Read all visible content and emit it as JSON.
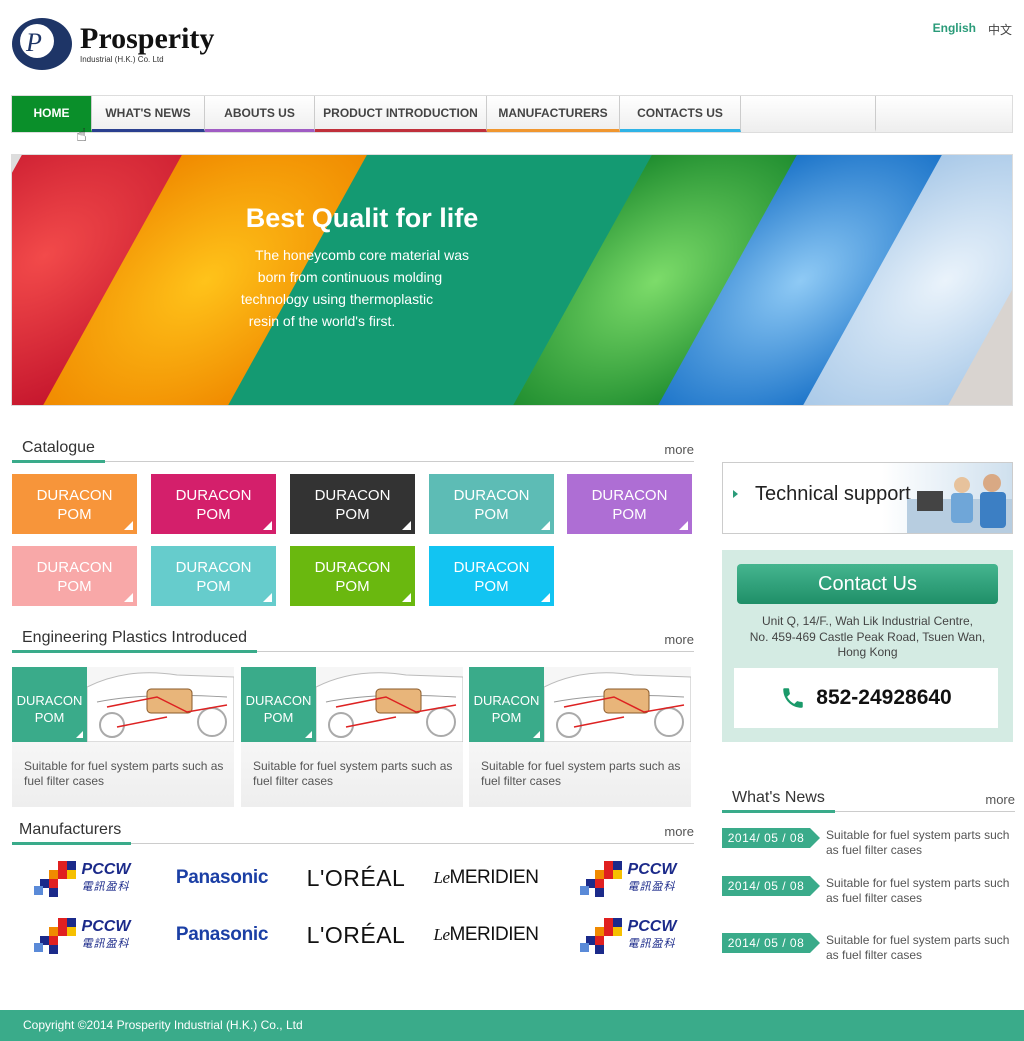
{
  "header": {
    "logo_letter": "P",
    "company_name": "Prosperity",
    "company_sub": "Industrial (H.K.) Co. Ltd",
    "lang_en": "English",
    "lang_zh": "中文"
  },
  "nav": {
    "items": [
      {
        "label": "HOME",
        "underline": "#0a8f2a"
      },
      {
        "label": "WHAT'S NEWS",
        "underline": "#2a3f8f"
      },
      {
        "label": "ABOUTS US",
        "underline": "#a05cc4"
      },
      {
        "label": "PRODUCT INTRODUCTION",
        "underline": "#c0303b"
      },
      {
        "label": "MANUFACTURERS",
        "underline": "#f0962f"
      },
      {
        "label": "CONTACTS US",
        "underline": "#2fb3e6"
      }
    ]
  },
  "banner": {
    "title": "Best Qualit for life",
    "body_lines": [
      "The honeycomb core material was",
      "born  from continuous molding",
      "technology using  thermoplastic",
      "resin of the world's  first."
    ],
    "green_color": "#149a72"
  },
  "catalogue": {
    "title": "Catalogue",
    "more": "more",
    "tiles": [
      {
        "line1": "DURACON",
        "line2": "POM",
        "color": "#f7953a"
      },
      {
        "line1": "DURACON",
        "line2": "POM",
        "color": "#d41f6b"
      },
      {
        "line1": "DURACON",
        "line2": "POM",
        "color": "#333333"
      },
      {
        "line1": "DURACON",
        "line2": "POM",
        "color": "#5dbcb5"
      },
      {
        "line1": "DURACON",
        "line2": "POM",
        "color": "#ae6ed4"
      },
      {
        "line1": "DURACON",
        "line2": "POM",
        "color": "#f8a8a8"
      },
      {
        "line1": "DURACON",
        "line2": "POM",
        "color": "#66cccc"
      },
      {
        "line1": "DURACON",
        "line2": "POM",
        "color": "#6ab80f"
      },
      {
        "line1": "DURACON",
        "line2": "POM",
        "color": "#12c4f2"
      }
    ]
  },
  "engineering": {
    "title": "Engineering Plastics Introduced",
    "more": "more",
    "cards": [
      {
        "line1": "DURACON",
        "line2": "POM",
        "desc": "Suitable for fuel system parts such as fuel filter cases"
      },
      {
        "line1": "DURACON",
        "line2": "POM",
        "desc": "Suitable for fuel system parts such as fuel filter cases"
      },
      {
        "line1": "DURACON",
        "line2": "POM",
        "desc": "Suitable for fuel system parts such as fuel filter cases"
      }
    ]
  },
  "manufacturers": {
    "title": "Manufacturers",
    "more": "more",
    "pccw_name": "PCCW",
    "pccw_cn": "電訊盈科",
    "panasonic": "Panasonic",
    "loreal": "L'ORÉAL",
    "meridien_le": "Le",
    "meridien": "MERIDIEN"
  },
  "sidebar": {
    "tech_support": "Technical support",
    "contact_title": "Contact Us",
    "address_lines": [
      "Unit Q, 14/F., Wah Lik Industrial Centre,",
      "No. 459-469 Castle Peak Road, Tsuen Wan,",
      "Hong Kong"
    ],
    "phone": "852-24928640",
    "news_title": "What's News",
    "news_more": "more",
    "news": [
      {
        "date": "2014/ 05 / 08",
        "text": "Suitable for fuel system parts such as fuel filter cases"
      },
      {
        "date": "2014/ 05 / 08",
        "text": "Suitable for fuel system parts such as fuel filter cases"
      },
      {
        "date": "2014/ 05 / 08",
        "text": "Suitable for fuel system parts such as fuel filter cases"
      }
    ]
  },
  "footer": {
    "copyright": "Copyright ©2014 Prosperity Industrial (H.K.) Co., Ltd"
  }
}
